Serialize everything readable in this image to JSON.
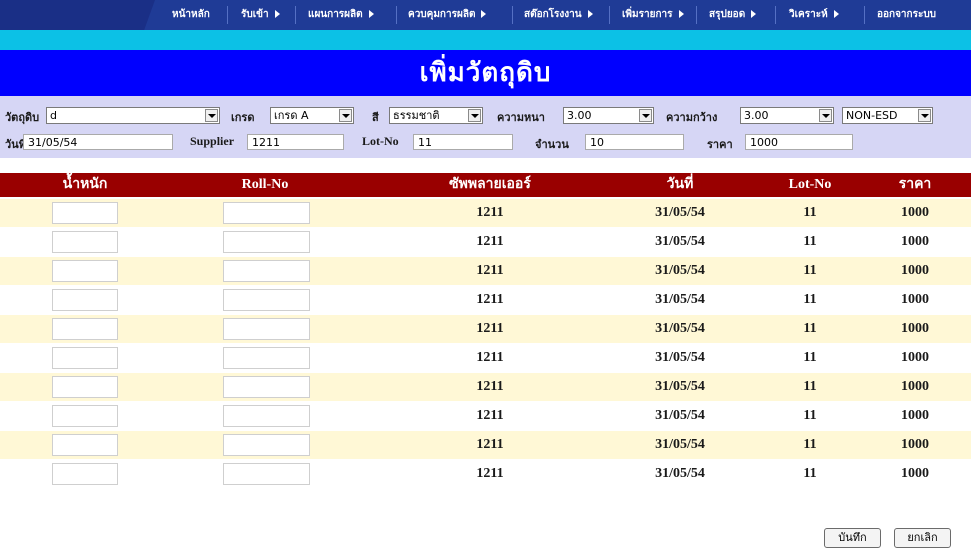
{
  "nav": {
    "items": [
      {
        "label": "หน้าหลัก",
        "arrow": false
      },
      {
        "label": "รับเข้า",
        "arrow": true
      },
      {
        "label": "แผนการผลิต",
        "arrow": true
      },
      {
        "label": "ควบคุมการผลิต",
        "arrow": true
      },
      {
        "label": "สต๊อกโรงงาน",
        "arrow": true
      },
      {
        "label": "เพิ่มรายการ",
        "arrow": true
      },
      {
        "label": "สรุปยอด",
        "arrow": true
      },
      {
        "label": "วิเคราะห์",
        "arrow": true
      },
      {
        "label": "ออกจากระบบ",
        "arrow": false
      }
    ]
  },
  "page": {
    "title": "เพิ่มวัตถุดิบ"
  },
  "filters": {
    "material_label": "วัตถุดิบ",
    "material_value": "d",
    "grade_label": "เกรด",
    "grade_value": "เกรด A",
    "color_label": "สี",
    "color_value": "ธรรมชาติ",
    "thickness_label": "ความหนา",
    "thickness_value": "3.00",
    "width_label": "ความกว้าง",
    "width_value": "3.00",
    "esd_value": "NON-ESD",
    "date_label": "วันที่",
    "date_value": "31/05/54",
    "supplier_label": "Supplier",
    "supplier_value": "1211",
    "lot_label": "Lot-No",
    "lot_value": "11",
    "qty_label": "จำนวน",
    "qty_value": "10",
    "price_label": "ราคา",
    "price_value": "1000"
  },
  "table": {
    "headers": [
      "น้ำหนัก",
      "Roll-No",
      "ซัพพลายเออร์",
      "วันที่",
      "Lot-No",
      "ราคา"
    ],
    "rows": [
      {
        "supplier": "1211",
        "date": "31/05/54",
        "lot": "11",
        "price": "1000"
      },
      {
        "supplier": "1211",
        "date": "31/05/54",
        "lot": "11",
        "price": "1000"
      },
      {
        "supplier": "1211",
        "date": "31/05/54",
        "lot": "11",
        "price": "1000"
      },
      {
        "supplier": "1211",
        "date": "31/05/54",
        "lot": "11",
        "price": "1000"
      },
      {
        "supplier": "1211",
        "date": "31/05/54",
        "lot": "11",
        "price": "1000"
      },
      {
        "supplier": "1211",
        "date": "31/05/54",
        "lot": "11",
        "price": "1000"
      },
      {
        "supplier": "1211",
        "date": "31/05/54",
        "lot": "11",
        "price": "1000"
      },
      {
        "supplier": "1211",
        "date": "31/05/54",
        "lot": "11",
        "price": "1000"
      },
      {
        "supplier": "1211",
        "date": "31/05/54",
        "lot": "11",
        "price": "1000"
      },
      {
        "supplier": "1211",
        "date": "31/05/54",
        "lot": "11",
        "price": "1000"
      }
    ]
  },
  "actions": {
    "save_label": "บันทึก",
    "cancel_label": "ยกเลิก"
  },
  "colors": {
    "nav_bg": "#1f3b96",
    "title_bg": "#0000ff",
    "strip": "#0cc1e6",
    "header_bg": "#990000",
    "row_alt": "#fff8d6",
    "filter_bg": "#d6d6f5"
  }
}
